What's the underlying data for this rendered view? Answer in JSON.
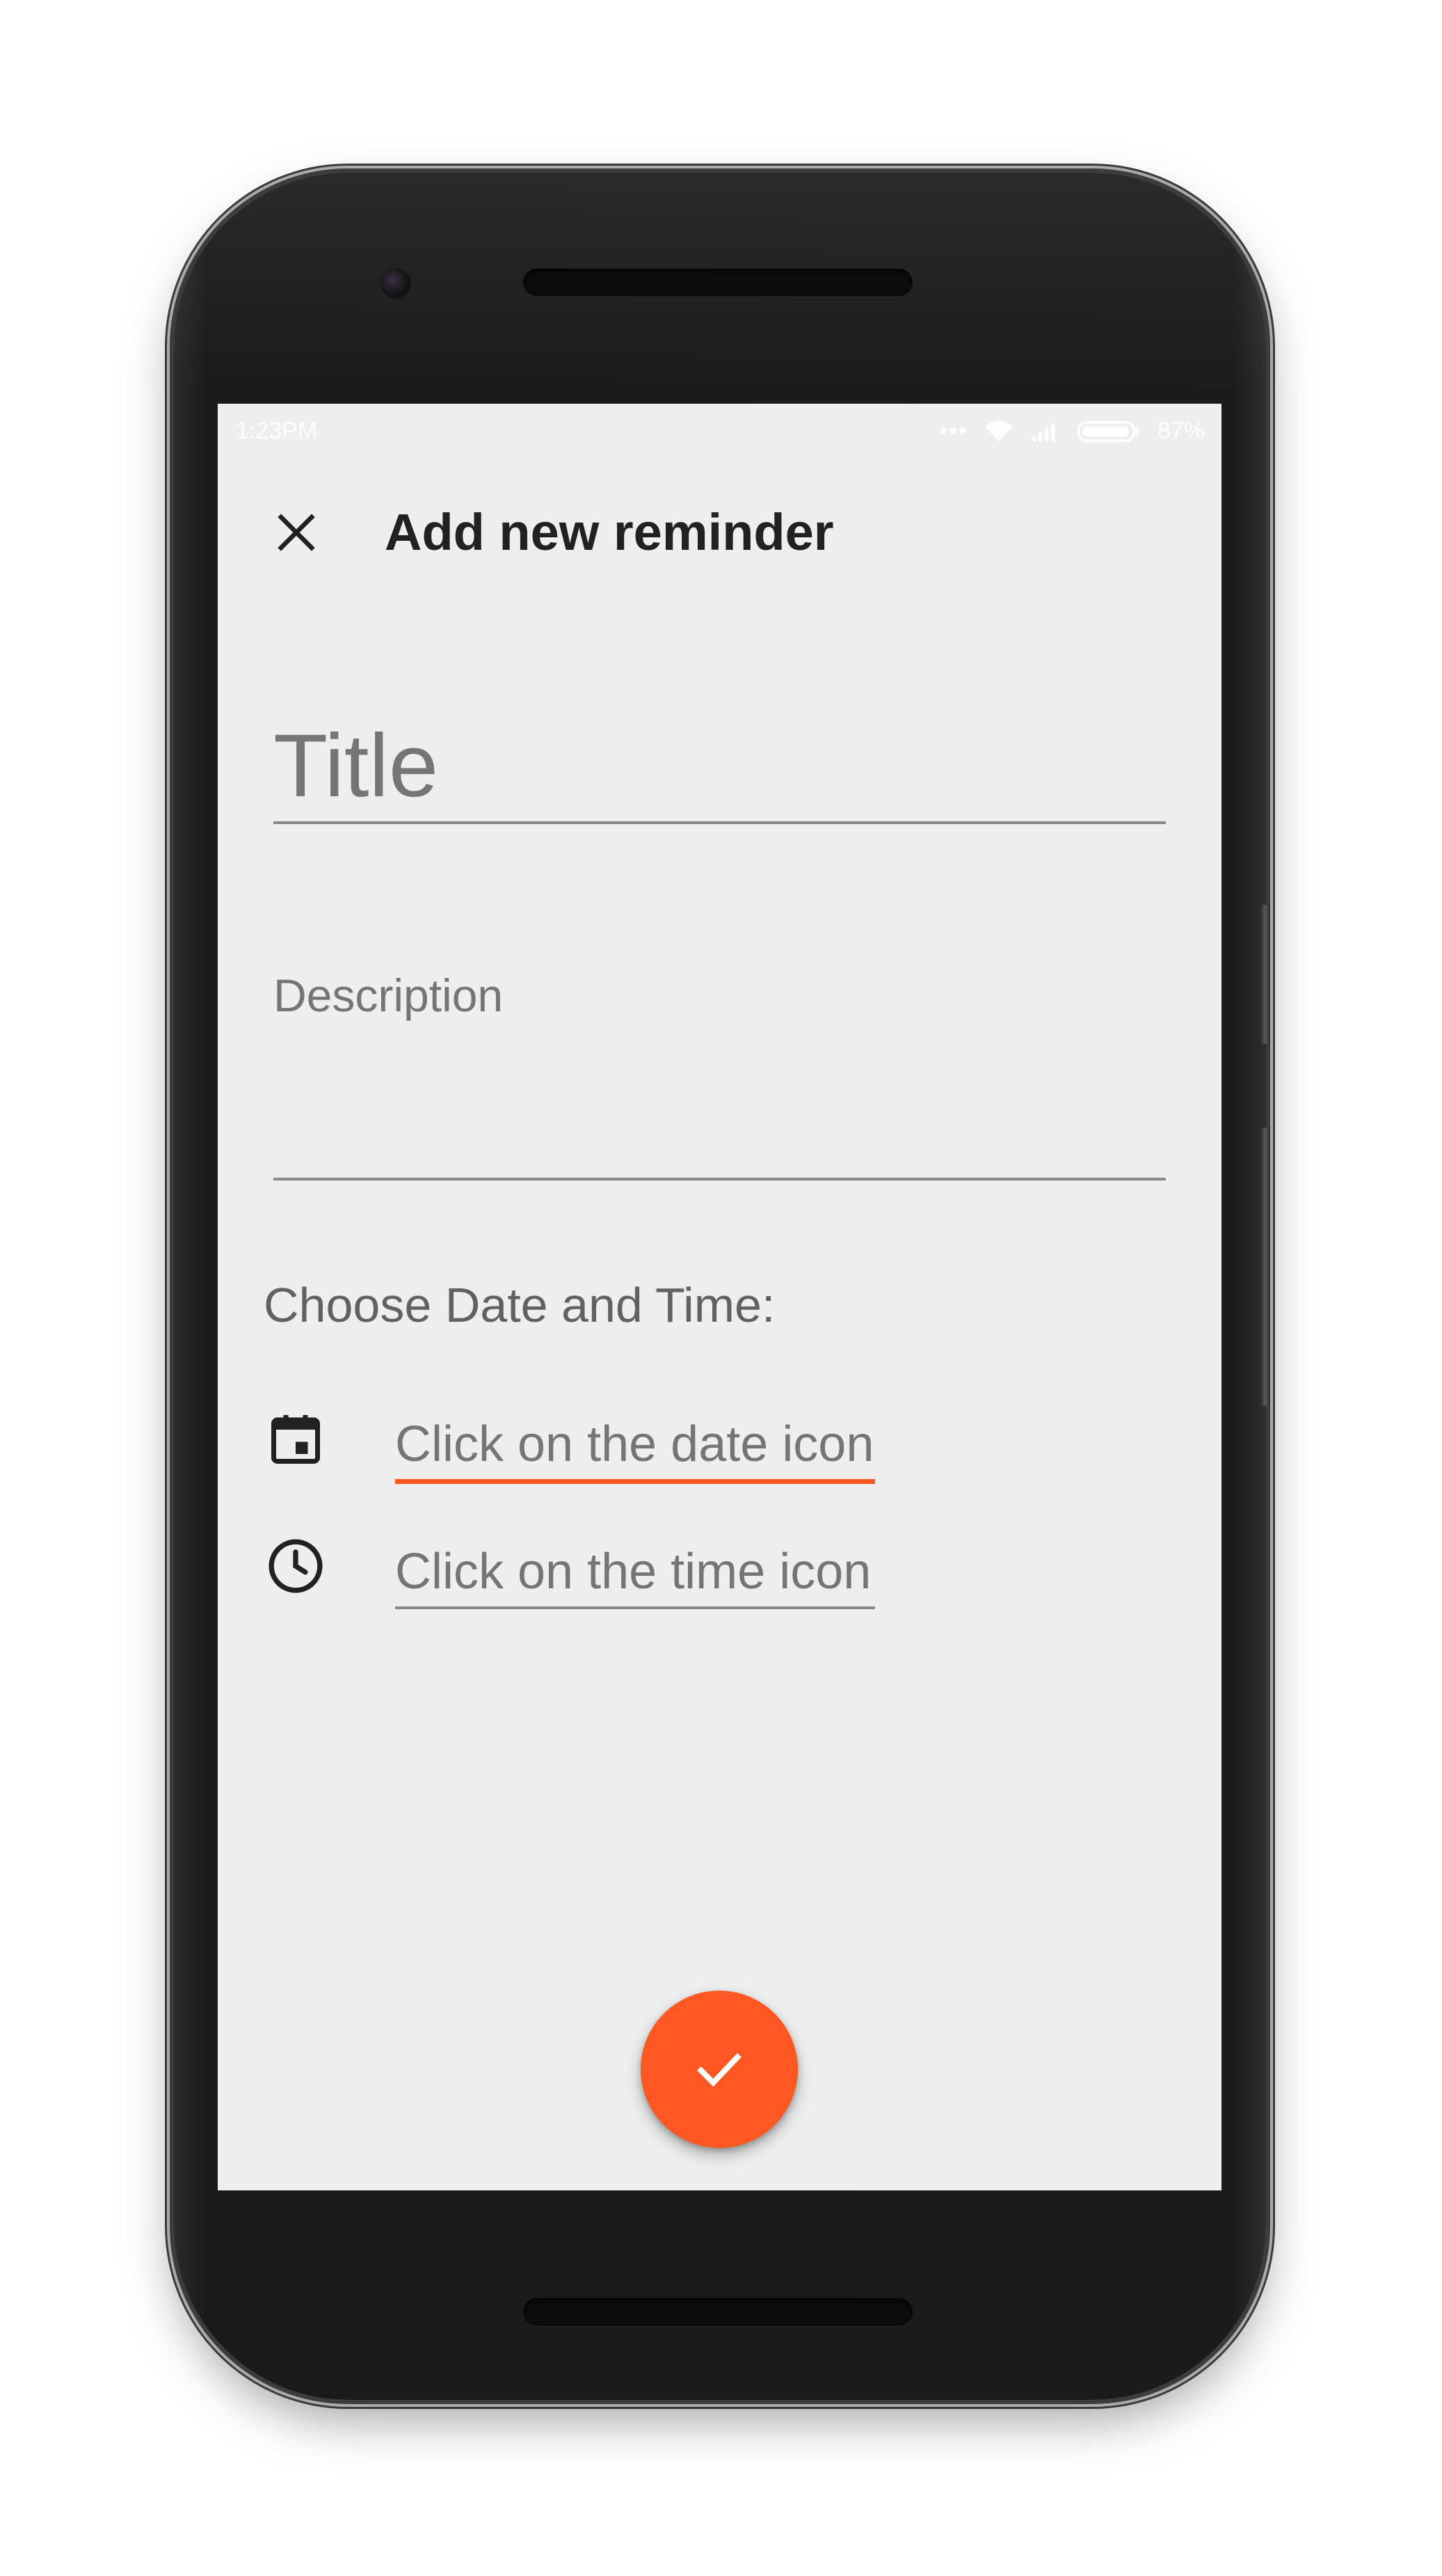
{
  "status_bar": {
    "time": "1:23PM",
    "battery_percent": "87%",
    "icons": [
      "more-dots-icon",
      "wifi-icon",
      "signal-icon",
      "battery-icon"
    ]
  },
  "toolbar": {
    "title": "Add new reminder",
    "close_icon": "close-icon"
  },
  "form": {
    "title_placeholder": "Title",
    "description_placeholder": "Description",
    "date_time_label": "Choose Date and Time:",
    "date_placeholder": "Click on the date icon",
    "time_placeholder": "Click on the time icon",
    "date_icon": "calendar-icon",
    "time_icon": "clock-icon"
  },
  "fab": {
    "icon": "check-icon"
  },
  "colors": {
    "accent": "#ff5722",
    "background": "#eeeeee",
    "title_text": "#212121",
    "hint_text": "#757575"
  }
}
